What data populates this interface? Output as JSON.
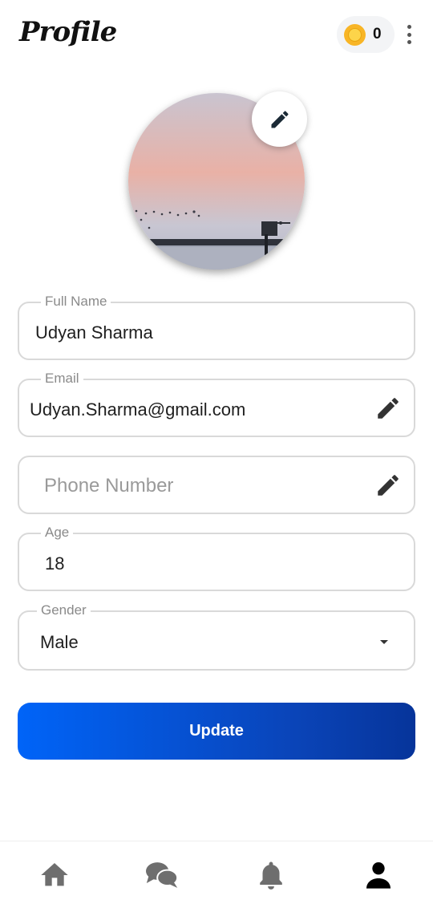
{
  "header": {
    "title": "Profile",
    "coin_count": "0",
    "coin_icon": "coin-icon",
    "menu_icon": "more-vert-icon"
  },
  "profile": {
    "avatar_alt": "profile photo",
    "edit_photo_icon": "pencil-icon"
  },
  "form": {
    "full_name": {
      "label": "Full Name",
      "value": "Udyan Sharma"
    },
    "email": {
      "label": "Email",
      "value": "Udyan.Sharma@gmail.com",
      "icon": "pencil-icon"
    },
    "phone": {
      "placeholder": "Phone Number",
      "value": "",
      "icon": "pencil-icon"
    },
    "age": {
      "label": "Age",
      "value": "18"
    },
    "gender": {
      "label": "Gender",
      "value": "Male",
      "icon": "dropdown-arrow-icon"
    }
  },
  "actions": {
    "update_label": "Update"
  },
  "bottom_nav": {
    "items": [
      {
        "icon": "home-icon",
        "active": false
      },
      {
        "icon": "chat-icon",
        "active": false
      },
      {
        "icon": "bell-icon",
        "active": false
      },
      {
        "icon": "person-icon",
        "active": true
      }
    ]
  },
  "colors": {
    "accent_start": "#0064f8",
    "accent_end": "#06349a",
    "coin": "#f8b526",
    "inactive_icon": "#6e6e6e",
    "active_icon": "#000000",
    "border": "#d9d9d9"
  }
}
